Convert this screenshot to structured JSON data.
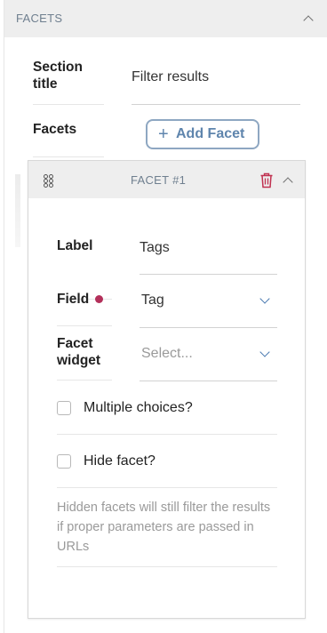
{
  "panel": {
    "title": "FACETS"
  },
  "section_title": {
    "label_line1": "Section",
    "label_line2": "title",
    "value": "Filter results"
  },
  "facets": {
    "label": "Facets",
    "add_button_label": "Add Facet",
    "add_button_icon": "plus-icon"
  },
  "facet_item": {
    "title": "FACET #1",
    "label_field": {
      "label": "Label",
      "value": "Tags"
    },
    "field_field": {
      "label": "Field",
      "value": "Tag",
      "required": true
    },
    "widget_field": {
      "label_line1": "Facet",
      "label_line2": "widget",
      "placeholder": "Select..."
    },
    "multiple_choices": {
      "label": "Multiple choices?",
      "checked": false
    },
    "hide_facet": {
      "label": "Hide facet?",
      "checked": false
    },
    "help_text": "Hidden facets will still filter the results if proper parameters are passed in URLs"
  },
  "colors": {
    "accent": "#5f85ad",
    "required_dot": "#b3305a",
    "delete_icon": "#c0304f",
    "header_bg": "#eeeeee"
  }
}
